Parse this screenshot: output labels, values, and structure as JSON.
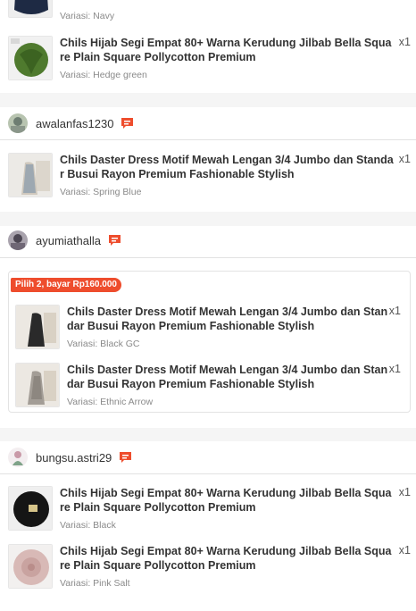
{
  "colors": {
    "accent": "#ee4d2d",
    "chat_icon": "#ee4d2d"
  },
  "groups": [
    {
      "items": [
        {
          "variant": "Variasi: Navy"
        },
        {
          "title": "Chils Hijab Segi Empat 80+ Warna Kerudung Jilbab Bella Square Plain Square Pollycotton Premium",
          "qty": "x1",
          "variant": "Variasi: Hedge green"
        }
      ]
    },
    {
      "buyer": "awalanfas1230",
      "items": [
        {
          "title": "Chils Daster Dress Motif Mewah Lengan 3/4 Jumbo dan Standar Busui Rayon Premium Fashionable Stylish",
          "qty": "x1",
          "variant": "Variasi: Spring Blue"
        }
      ]
    },
    {
      "buyer": "ayumiathalla",
      "promo": "Pilih 2, bayar Rp160.000",
      "items": [
        {
          "title": "Chils Daster Dress Motif Mewah Lengan 3/4 Jumbo dan Standar Busui Rayon Premium Fashionable Stylish",
          "qty": "x1",
          "variant": "Variasi: Black GC"
        },
        {
          "title": "Chils Daster Dress Motif Mewah Lengan 3/4 Jumbo dan Standar Busui Rayon Premium Fashionable Stylish",
          "qty": "x1",
          "variant": "Variasi: Ethnic Arrow"
        }
      ]
    },
    {
      "buyer": "bungsu.astri29",
      "items": [
        {
          "title": "Chils Hijab Segi Empat 80+ Warna Kerudung Jilbab Bella Square Plain Square Pollycotton Premium",
          "qty": "x1",
          "variant": "Variasi: Black"
        },
        {
          "title": "Chils Hijab Segi Empat 80+ Warna Kerudung Jilbab Bella Square Plain Square Pollycotton Premium",
          "qty": "x1",
          "variant": "Variasi: Pink Salt"
        }
      ]
    }
  ]
}
